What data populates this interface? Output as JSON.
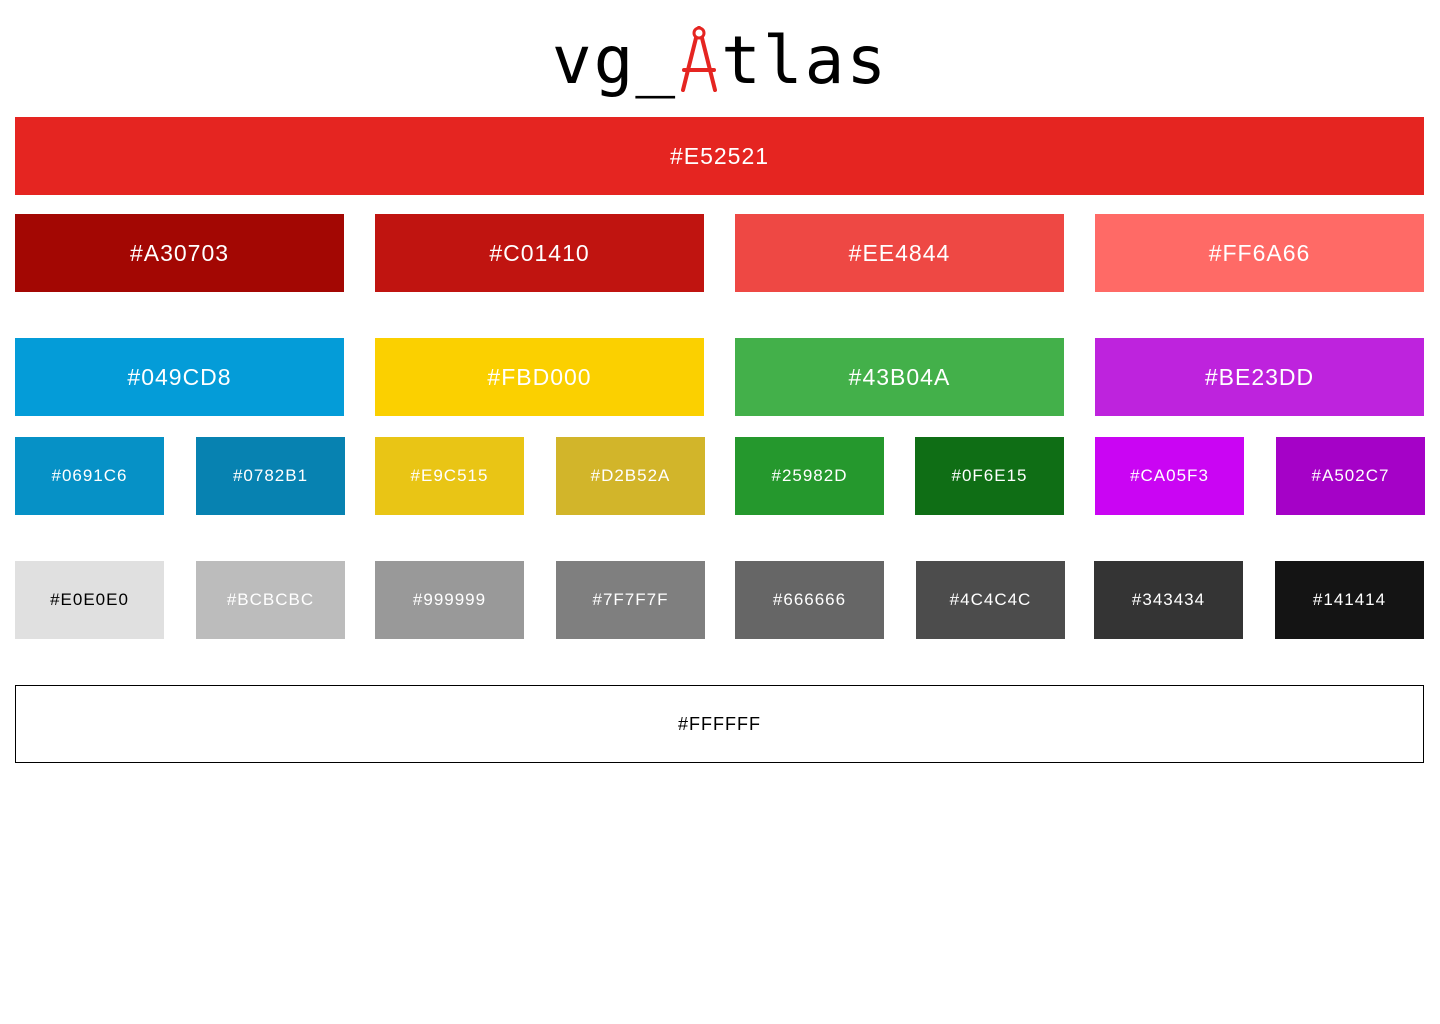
{
  "logo": {
    "prefix": "vg_",
    "suffix": "tlas",
    "accent_color": "#E52521",
    "icon": "drafting-compass-icon"
  },
  "primary": {
    "label": "#E52521",
    "color": "#E52521"
  },
  "reds": [
    {
      "label": "#A30703",
      "color": "#A30703"
    },
    {
      "label": "#C01410",
      "color": "#C01410"
    },
    {
      "label": "#EE4844",
      "color": "#EE4844"
    },
    {
      "label": "#FF6A66",
      "color": "#FF6A66"
    }
  ],
  "accents": [
    {
      "label": "#049CD8",
      "color": "#049CD8"
    },
    {
      "label": "#FBD000",
      "color": "#FBD000"
    },
    {
      "label": "#43B04A",
      "color": "#43B04A"
    },
    {
      "label": "#BE23DD",
      "color": "#BE23DD"
    }
  ],
  "accent_shades": [
    {
      "label": "#0691C6",
      "color": "#0691C6"
    },
    {
      "label": "#0782B1",
      "color": "#0782B1"
    },
    {
      "label": "#E9C515",
      "color": "#E9C515"
    },
    {
      "label": "#D2B52A",
      "color": "#D2B52A"
    },
    {
      "label": "#25982D",
      "color": "#25982D"
    },
    {
      "label": "#0F6E15",
      "color": "#0F6E15"
    },
    {
      "label": "#CA05F3",
      "color": "#CA05F3"
    },
    {
      "label": "#A502C7",
      "color": "#A502C7"
    }
  ],
  "grays": [
    {
      "label": "#E0E0E0",
      "color": "#E0E0E0",
      "text_color": "#000000"
    },
    {
      "label": "#BCBCBC",
      "color": "#BCBCBC",
      "text_color": "#FFFFFF"
    },
    {
      "label": "#999999",
      "color": "#999999",
      "text_color": "#FFFFFF"
    },
    {
      "label": "#7F7F7F",
      "color": "#7F7F7F",
      "text_color": "#FFFFFF"
    },
    {
      "label": "#666666",
      "color": "#666666",
      "text_color": "#FFFFFF"
    },
    {
      "label": "#4C4C4C",
      "color": "#4C4C4C",
      "text_color": "#FFFFFF"
    },
    {
      "label": "#343434",
      "color": "#343434",
      "text_color": "#FFFFFF"
    },
    {
      "label": "#141414",
      "color": "#141414",
      "text_color": "#FFFFFF"
    }
  ],
  "white": {
    "label": "#FFFFFF",
    "color": "#FFFFFF",
    "text_color": "#000000"
  }
}
